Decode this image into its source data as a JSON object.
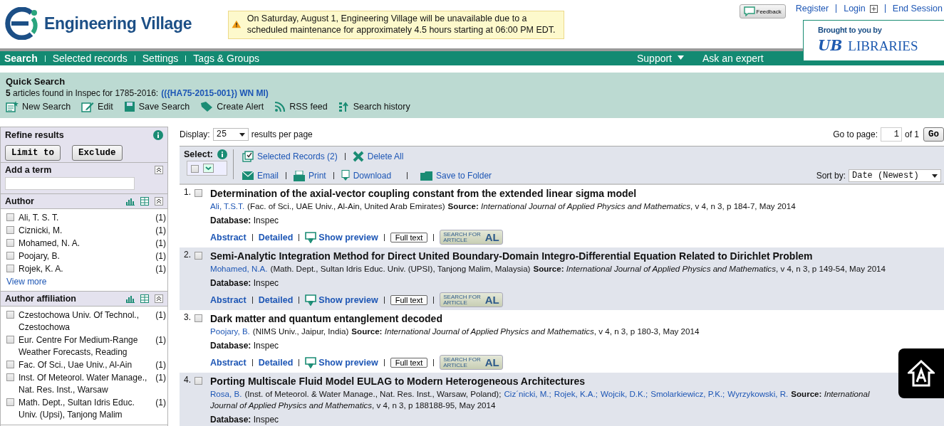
{
  "header": {
    "logo_text": "Engineering Village",
    "notice": "On Saturday, August 1, Engineering Village will be unavailable due to a scheduled maintenance for approximately 4.5 hours starting at 06:00 PM EDT.",
    "feedback": "Feedback",
    "links": [
      {
        "label": "Register",
        "kind": "link"
      },
      {
        "label": "Login",
        "kind": "menu"
      },
      {
        "label": "End Session",
        "kind": "link"
      }
    ],
    "sponsor": {
      "caption": "Brought to you by",
      "logo_mark": "UB",
      "logo_text": "LIBRARIES"
    }
  },
  "nav": {
    "left": [
      {
        "label": "Search",
        "selected": true
      },
      {
        "label": "Selected records",
        "selected": false
      },
      {
        "label": "Settings",
        "selected": false
      },
      {
        "label": "Tags & Groups",
        "selected": false
      }
    ],
    "right": [
      {
        "label": "Support",
        "kind": "dropdown"
      },
      {
        "label": "Ask an expert",
        "kind": "link"
      }
    ]
  },
  "quick_search": {
    "title": "Quick Search",
    "summary": "**5** articles found in Inspec for 1785-2016:",
    "query": "(({HA75-2015-001}) WN MI)",
    "actions": [
      {
        "label": "New Search",
        "kind": "new"
      },
      {
        "label": "Edit",
        "kind": "edit"
      },
      {
        "label": "Save Search",
        "kind": "save"
      },
      {
        "label": "Create Alert",
        "kind": "alert"
      },
      {
        "label": "RSS feed",
        "kind": "rss"
      },
      {
        "label": "Search history",
        "kind": "history"
      }
    ]
  },
  "sidebar": {
    "title": "Refine results",
    "buttons": [
      "Limit to",
      "Exclude"
    ],
    "add_term": "Add a term",
    "facets": [
      {
        "title": "Author",
        "more": "View more",
        "items": [
          {
            "label": "Ali, T. S. T.",
            "count": "(1)",
            "checked": false
          },
          {
            "label": "Ciznicki, M.",
            "count": "(1)",
            "checked": false
          },
          {
            "label": "Mohamed, N. A.",
            "count": "(1)",
            "checked": false
          },
          {
            "label": "Poojary, B.",
            "count": "(1)",
            "checked": false
          },
          {
            "label": "Rojek, K. A.",
            "count": "(1)",
            "checked": false
          }
        ]
      },
      {
        "title": "Author affiliation",
        "items": [
          {
            "label": "Czestochowa Univ. Of Technol., Czestochowa",
            "count": "(1)",
            "checked": false
          },
          {
            "label": "Eur. Centre For Medium-Range Weather Forecasts, Reading",
            "count": "(1)",
            "checked": false
          },
          {
            "label": "Fac. Of Sci., Uae Univ., Al-Ain",
            "count": "(1)",
            "checked": false
          },
          {
            "label": "Inst. Of Meteorol. Water Manage., Nat. Res. Inst., Warsaw",
            "count": "(1)",
            "checked": false
          },
          {
            "label": "Math. Dept., Sultan Idris Educ. Univ. (Upsi), Tanjong Malim",
            "count": "(1)",
            "checked": false
          }
        ]
      }
    ]
  },
  "toolbar": {
    "display_label": "Display:",
    "display_value": "25",
    "display_suffix": "results per page",
    "goto_label": "Go to page:",
    "goto_value": "1",
    "goto_suffix": "of 1",
    "goto_button": "Go",
    "select_label": "Select:",
    "select_all_checked": false,
    "actions_top": [
      {
        "label": "Selected Records (2)",
        "kind": "selected"
      },
      {
        "label": "Delete All",
        "kind": "delete"
      }
    ],
    "actions_bottom": [
      {
        "label": "Email",
        "kind": "email"
      },
      {
        "label": "Print",
        "kind": "print"
      },
      {
        "label": "Download",
        "kind": "download"
      },
      {
        "label": "Save to Folder",
        "kind": "folder"
      }
    ],
    "sort_label": "Sort by:",
    "sort_value": "Date (Newest)"
  },
  "results": [
    {
      "number": "1.",
      "checked": false,
      "title": "Determination of the axial-vector coupling constant from the extended linear sigma model",
      "authors": [
        {
          "name": "Ali, T.S.T.",
          "affiliation": "(Fac. of Sci., UAE Univ., Al-Ain, United Arab Emirates)"
        }
      ],
      "source_label": "Source:",
      "journal": "International Journal of Applied Physics and Mathematics",
      "details": ", v 4, n 3, p 184-7, May 2014",
      "database_label": "Database:",
      "database": "Inspec",
      "links": [
        "Abstract",
        "Detailed",
        "Show preview"
      ],
      "full_text": "Full text",
      "article_button": {
        "line1": "SEARCH FOR",
        "line2": "ARTICLE",
        "mark": "AL"
      }
    },
    {
      "number": "2.",
      "checked": false,
      "title": "Semi-Analytic Integration Method for Direct United Boundary-Domain Integro-Differential Equation Related to Dirichlet Problem",
      "authors": [
        {
          "name": "Mohamed, N.A.",
          "affiliation": "(Math. Dept., Sultan Idris Educ. Univ. (UPSI), Tanjong Malim, Malaysia)"
        }
      ],
      "source_label": "Source:",
      "journal": "International Journal of Applied Physics and Mathematics",
      "details": ", v 4, n 3, p 149-54, May 2014",
      "database_label": "Database:",
      "database": "Inspec",
      "links": [
        "Abstract",
        "Detailed",
        "Show preview"
      ],
      "full_text": "Full text",
      "article_button": {
        "line1": "SEARCH FOR",
        "line2": "ARTICLE",
        "mark": "AL"
      }
    },
    {
      "number": "3.",
      "checked": false,
      "title": "Dark matter and quantum entanglement decoded",
      "authors": [
        {
          "name": "Poojary, B.",
          "affiliation": "(NIMS Univ., Jaipur, India)"
        }
      ],
      "source_label": "Source:",
      "journal": "International Journal of Applied Physics and Mathematics",
      "details": ", v 4, n 3, p 180-3, May 2014",
      "database_label": "Database:",
      "database": "Inspec",
      "links": [
        "Abstract",
        "Detailed",
        "Show preview"
      ],
      "full_text": "Full text",
      "article_button": {
        "line1": "SEARCH FOR",
        "line2": "ARTICLE",
        "mark": "AL"
      }
    },
    {
      "number": "4.",
      "checked": false,
      "title": "Porting Multiscale Fluid Model EULAG to Modern Heterogeneous Architectures",
      "authors": [
        {
          "name": "Rosa, B.",
          "affiliation": "(Inst. of Meteorol. & Water Manage., Nat. Res. Inst., Warsaw, Poland);"
        },
        {
          "name": "Ciz´nicki, M.;"
        },
        {
          "name": "Rojek, K.A.;"
        },
        {
          "name": "Wojcik, D.K.;"
        },
        {
          "name": "Smolarkiewicz, P.K.;"
        },
        {
          "name": "Wyrzykowski, R."
        }
      ],
      "source_label": "Source:",
      "journal": "International Journal of Applied Physics and Mathematics",
      "details": ", v 4, n 3, p 188188-95, May 2014",
      "database_label": "Database:",
      "database": "Inspec"
    }
  ]
}
